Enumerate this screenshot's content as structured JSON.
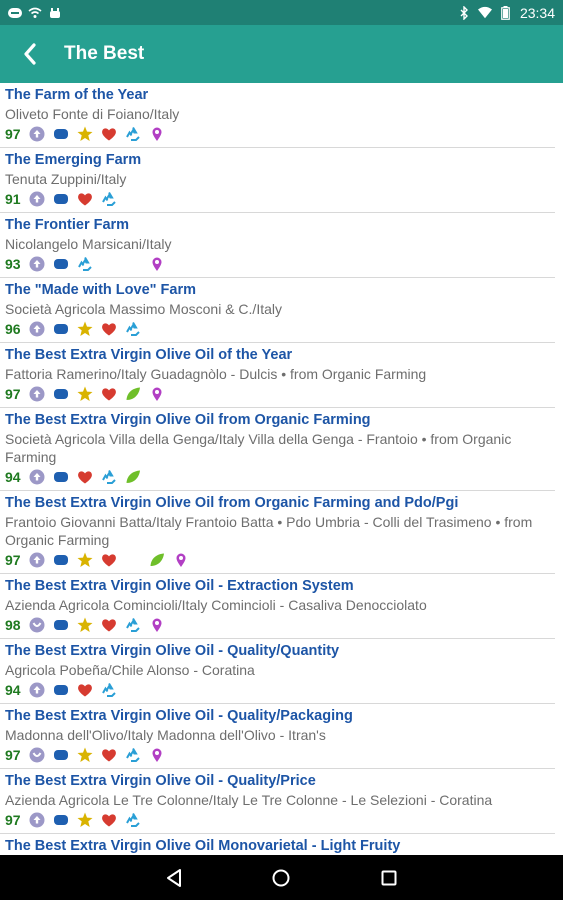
{
  "status_bar": {
    "time": "23:34",
    "battery_level": 1.0
  },
  "app_bar": {
    "title": "The Best",
    "color": "#26a091"
  },
  "icon_colors": {
    "gold_medal": "#d9b300",
    "heart": "#d63b30",
    "recycle": "#2a9fd6",
    "leaf": "#6fbf2a",
    "pin": "#b23fc4",
    "arrow_circle": "#9c98c7",
    "blue_shape": "#1e5fb0"
  },
  "items": [
    {
      "title": "The Farm of the Year",
      "subtitle": "Oliveto Fonte di Foiano/Italy",
      "score": "97",
      "icons": [
        "arrow-up-circle",
        "blue-pill",
        "star",
        "heart",
        "recycle",
        "pin"
      ]
    },
    {
      "title": "The Emerging Farm",
      "subtitle": "Tenuta Zuppini/Italy",
      "score": "91",
      "icons": [
        "arrow-up-circle",
        "blue-pill",
        "heart",
        "recycle"
      ]
    },
    {
      "title": "The Frontier Farm",
      "subtitle": "Nicolangelo Marsicani/Italy",
      "score": "93",
      "icons": [
        "arrow-up-circle",
        "blue-pill",
        "recycle",
        "",
        "",
        "pin"
      ]
    },
    {
      "title": "The \"Made with Love\" Farm",
      "subtitle": "Società Agricola Massimo Mosconi & C./Italy",
      "score": "96",
      "icons": [
        "arrow-up-circle",
        "blue-pill",
        "star",
        "heart",
        "recycle"
      ]
    },
    {
      "title": "The Best Extra Virgin Olive Oil of the Year",
      "subtitle": "Fattoria Ramerino/Italy Guadagnòlo - Dulcis • from Organic Farming",
      "score": "97",
      "icons": [
        "arrow-up-circle",
        "blue-pill",
        "star",
        "heart",
        "leaf",
        "pin"
      ]
    },
    {
      "title": "The Best Extra Virgin Olive Oil from Organic Farming",
      "subtitle": "Società Agricola Villa della Genga/Italy Villa della Genga - Frantoio • from Organic Farming",
      "score": "94",
      "icons": [
        "arrow-up-circle",
        "blue-pill",
        "heart",
        "recycle",
        "leaf"
      ]
    },
    {
      "title": "The Best Extra Virgin Olive Oil from Organic Farming and Pdo/Pgi",
      "subtitle": "Frantoio Giovanni Batta/Italy Frantoio Batta • Pdo Umbria - Colli del Trasimeno • from Organic Farming",
      "score": "97",
      "icons": [
        "arrow-up-circle",
        "blue-pill",
        "star",
        "heart",
        "",
        "leaf",
        "pin"
      ]
    },
    {
      "title": "The Best Extra Virgin Olive Oil - Extraction System",
      "subtitle": "Azienda Agricola Comincioli/Italy Comincioli - Casaliva Denocciolato",
      "score": "98",
      "icons": [
        "arrow-down-circle",
        "blue-pill",
        "star",
        "heart",
        "recycle",
        "pin"
      ]
    },
    {
      "title": "The Best Extra Virgin Olive Oil - Quality/Quantity",
      "subtitle": "Agricola Pobeña/Chile Alonso - Coratina",
      "score": "94",
      "icons": [
        "arrow-up-circle",
        "blue-pill",
        "heart",
        "recycle"
      ]
    },
    {
      "title": "The Best Extra Virgin Olive Oil - Quality/Packaging",
      "subtitle": "Madonna dell'Olivo/Italy Madonna dell'Olivo - Itran's",
      "score": "97",
      "icons": [
        "arrow-down-circle",
        "blue-pill",
        "star",
        "heart",
        "recycle",
        "pin"
      ]
    },
    {
      "title": "The Best Extra Virgin Olive Oil - Quality/Price",
      "subtitle": "Azienda Agricola Le Tre Colonne/Italy Le Tre Colonne - Le Selezioni - Coratina",
      "score": "97",
      "icons": [
        "arrow-up-circle",
        "blue-pill",
        "star",
        "heart",
        "recycle"
      ]
    },
    {
      "title": "The Best Extra Virgin Olive Oil Monovarietal - Light Fruity",
      "subtitle": "",
      "score": "",
      "icons": []
    }
  ]
}
